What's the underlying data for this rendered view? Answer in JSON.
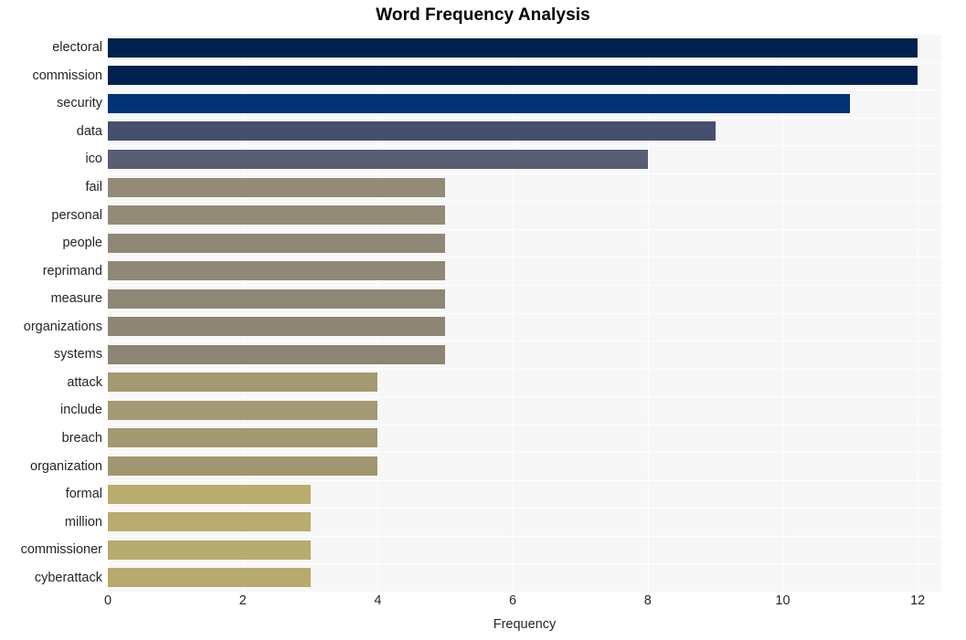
{
  "chart_data": {
    "type": "bar",
    "orientation": "horizontal",
    "title": "Word Frequency Analysis",
    "xlabel": "Frequency",
    "ylabel": "",
    "xlim": [
      0,
      12.35
    ],
    "ylim": [
      0,
      20
    ],
    "xticks": [
      0,
      2,
      4,
      6,
      8,
      10,
      12
    ],
    "xticklabels": [
      "0",
      "2",
      "4",
      "6",
      "8",
      "10",
      "12"
    ],
    "grid": true,
    "legend": null,
    "categories": [
      "electoral",
      "commission",
      "security",
      "data",
      "ico",
      "fail",
      "personal",
      "people",
      "reprimand",
      "measure",
      "organizations",
      "systems",
      "attack",
      "include",
      "breach",
      "organization",
      "formal",
      "million",
      "commissioner",
      "cyberattack"
    ],
    "values": [
      12,
      12,
      11,
      9,
      8,
      5,
      5,
      5,
      5,
      5,
      5,
      5,
      4,
      4,
      4,
      4,
      3,
      3,
      3,
      3
    ],
    "bar_colors": [
      "#00204d",
      "#00214f",
      "#003377",
      "#454f6e",
      "#585e74",
      "#938b78",
      "#938b78",
      "#908877",
      "#8f8876",
      "#8e8775",
      "#8d8674",
      "#8c8573",
      "#a39a72",
      "#a39a72",
      "#a29971",
      "#a09770",
      "#b9ac6f",
      "#b9ac6f",
      "#b8ab6e",
      "#b7aa6d"
    ],
    "plot_bgcolor": "#f7f7f7",
    "gridcolor": "#ffffff",
    "figure_bgcolor": "#ffffff"
  }
}
